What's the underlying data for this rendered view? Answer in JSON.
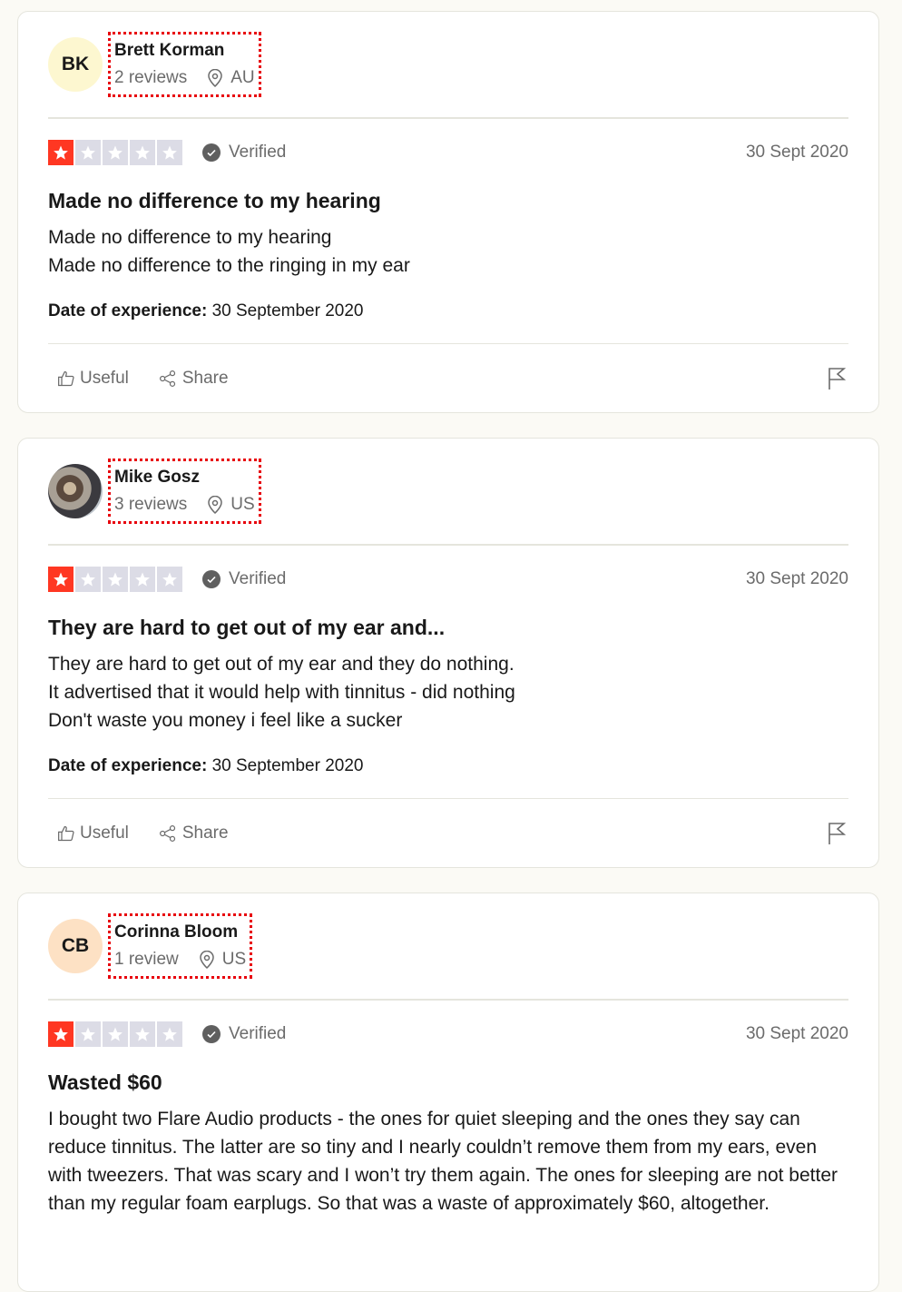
{
  "colors": {
    "star_active": "#ff3722",
    "star_inactive": "#dcdce6",
    "highlight_box": "#e8000b"
  },
  "labels": {
    "verified": "Verified",
    "date_of_experience": "Date of experience:",
    "useful": "Useful",
    "share": "Share"
  },
  "reviews": [
    {
      "initials": "BK",
      "avatar_color": "#fdf7d0",
      "avatar_type": "initials",
      "name": "Brett Korman",
      "review_count": "2 reviews",
      "country": "AU",
      "rating": 1,
      "date": "30 Sept 2020",
      "title": "Made no difference to my hearing",
      "body": [
        "Made no difference to my hearing",
        "Made no difference to the ringing in my ear"
      ],
      "experience_date": "30 September 2020"
    },
    {
      "initials": "",
      "avatar_type": "photo",
      "name": "Mike Gosz",
      "review_count": "3 reviews",
      "country": "US",
      "rating": 1,
      "date": "30 Sept 2020",
      "title": "They are hard to get out of my ear and...",
      "body": [
        "They are hard to get out of my ear and they do nothing.",
        "It advertised that it would help with tinnitus - did nothing",
        "Don't waste you money i feel like a sucker"
      ],
      "experience_date": "30 September 2020"
    },
    {
      "initials": "CB",
      "avatar_color": "#fde1c4",
      "avatar_type": "initials",
      "name": "Corinna Bloom",
      "review_count": "1 review",
      "country": "US",
      "rating": 1,
      "date": "30 Sept 2020",
      "title": "Wasted $60",
      "body": [
        "I bought two Flare Audio products - the ones for quiet sleeping and the ones they say can reduce tinnitus. The latter are so tiny and I nearly couldn’t remove them from my ears, even with tweezers. That was scary and I won’t try them again. The ones for sleeping are not better than my regular foam earplugs. So that was a waste of approximately $60, altogether."
      ],
      "experience_date": ""
    }
  ]
}
